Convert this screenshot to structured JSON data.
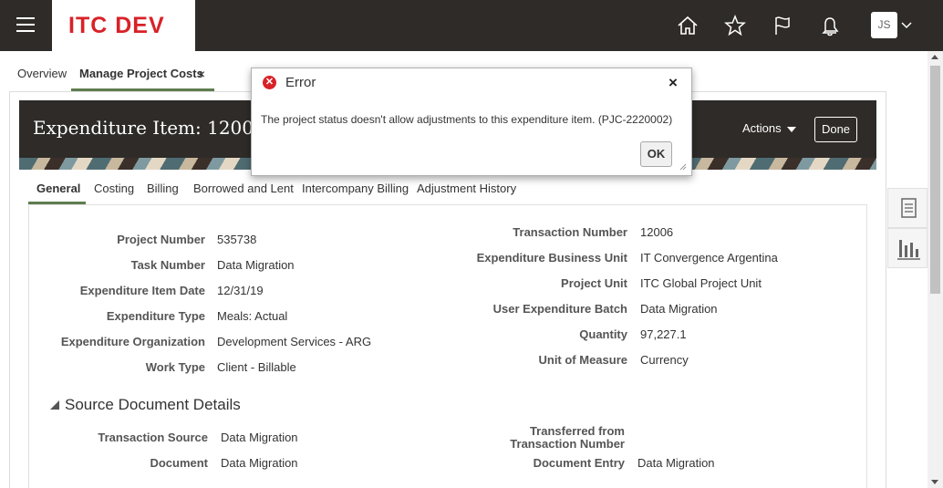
{
  "header": {
    "brand": "ITC DEV",
    "user_initials": "JS",
    "icons": [
      "home-icon",
      "favorites-star-icon",
      "watchlist-flag-icon",
      "notifications-bell-icon"
    ]
  },
  "page_tabs": {
    "overview": "Overview",
    "manage": "Manage Project Costs",
    "close": "×"
  },
  "page": {
    "title": "Expenditure Item: 12006",
    "actions_label": "Actions",
    "done_label": "Done"
  },
  "subtabs": [
    "General",
    "Costing",
    "Billing",
    "Borrowed and Lent",
    "Intercompany Billing",
    "Adjustment History"
  ],
  "general": {
    "left": [
      {
        "label": "Project Number",
        "value": "535738"
      },
      {
        "label": "Task Number",
        "value": "Data Migration"
      },
      {
        "label": "Expenditure Item Date",
        "value": "12/31/19"
      },
      {
        "label": "Expenditure Type",
        "value": "Meals: Actual"
      },
      {
        "label": "Expenditure Organization",
        "value": "Development Services - ARG"
      },
      {
        "label": "Work Type",
        "value": "Client - Billable"
      }
    ],
    "right": [
      {
        "label": "Transaction Number",
        "value": "12006"
      },
      {
        "label": "Expenditure Business Unit",
        "value": "IT Convergence Argentina"
      },
      {
        "label": "Project Unit",
        "value": "ITC Global Project Unit"
      },
      {
        "label": "User Expenditure Batch",
        "value": "Data Migration"
      },
      {
        "label": "Quantity",
        "value": "97,227.1"
      },
      {
        "label": "Unit of Measure",
        "value": "Currency"
      }
    ]
  },
  "source_section": {
    "title": "Source Document Details",
    "transaction_source_label": "Transaction Source",
    "transaction_source_value": "Data Migration",
    "document_label": "Document",
    "document_value": "Data Migration",
    "transferred_label_1": "Transferred from",
    "transferred_label_2": "Transaction Number",
    "document_entry_label": "Document Entry",
    "document_entry_value": "Data Migration"
  },
  "dialog": {
    "title": "Error",
    "message": "The project status doesn't allow adjustments to this expenditure item. (PJC-2220002)",
    "ok_label": "OK",
    "close": "×"
  },
  "colors": {
    "topbar": "#2e2b28",
    "brand_red": "#d92128",
    "tab_underline": "#5f7d4f"
  }
}
